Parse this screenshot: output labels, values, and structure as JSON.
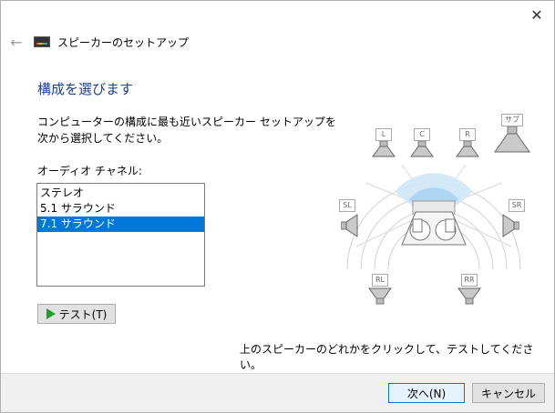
{
  "window": {
    "title": "スピーカーのセットアップ",
    "close_glyph": "✕",
    "back_glyph": "←"
  },
  "page": {
    "heading": "構成を選びます",
    "description": "コンピューターの構成に最も近いスピーカー セットアップを次から選択してください。",
    "channel_label": "オーディオ チャネル:",
    "channels": [
      {
        "label": "ステレオ",
        "selected": false
      },
      {
        "label": "5.1 サラウンド",
        "selected": false
      },
      {
        "label": "7.1 サラウンド",
        "selected": true
      }
    ],
    "test_button_label": "テスト(T)",
    "hint": "上のスピーカーのどれかをクリックして、テストしてください。"
  },
  "speakers": {
    "labels": {
      "L": "L",
      "C": "C",
      "R": "R",
      "SUB": "サブ",
      "SL": "SL",
      "SR": "SR",
      "RL": "RL",
      "RR": "RR"
    }
  },
  "footer": {
    "next_label": "次へ(N)",
    "cancel_label": "キャンセル"
  },
  "colors": {
    "heading": "#1c3f95",
    "selection": "#0078d7",
    "play": "#1f9e2c"
  }
}
